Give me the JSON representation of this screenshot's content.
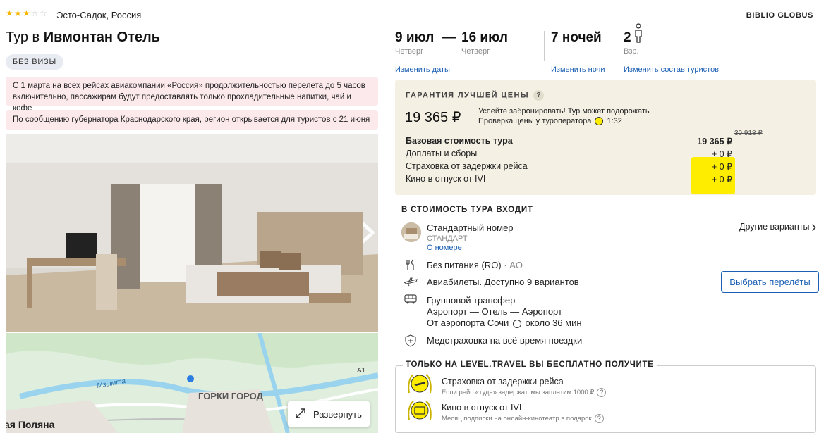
{
  "hotel": {
    "stars": 3,
    "max_stars": 5,
    "location": "Эсто-Садок, Россия",
    "title_prefix": "Тур в",
    "name": "Ивмонтан Отель",
    "visa_badge": "БЕЗ ВИЗЫ"
  },
  "operator": "BIBLIO GLOBUS",
  "notices": [
    "С 1 марта на всех рейсах авиакомпании «Россия» продолжительностью перелета до 5 часов включительно, пассажирам будут предоставлять только прохладительные напитки, чай и кофе",
    "По сообщению губернатора Краснодарского края, регион открывается для туристов с 21 июня"
  ],
  "map": {
    "labels": [
      "ГОРКИ ГОРОД",
      "ая Поляна",
      "Мзымта",
      "A1"
    ],
    "expand_label": "Развернуть"
  },
  "trip": {
    "date_from": "9 июл",
    "dash": "—",
    "date_to": "16 июл",
    "day_from": "Четверг",
    "day_to": "Четверг",
    "nights": "7 ночей",
    "travellers": "2",
    "travellers_label": "Взр.",
    "change_dates": "Изменить даты",
    "change_nights": "Изменить ночи",
    "change_travellers": "Изменить состав туристов"
  },
  "price": {
    "guarantee": "ГАРАНТИЯ ЛУЧШЕЙ ЦЕНЫ",
    "q": "?",
    "total": "19 365 ₽",
    "hurry": "Успейте забронировать! Тур может подорожать",
    "check": "Проверка цены у туроператора",
    "timer": "1:32",
    "old_price": "30 918 ₽",
    "rows": [
      {
        "label": "Базовая стоимость тура",
        "value": "19 365 ₽"
      },
      {
        "label": "Доплаты и сборы",
        "value": "+ 0 ₽"
      },
      {
        "label": "Страховка от задержки рейса",
        "value": "+ 0 ₽"
      },
      {
        "label": "Кино в отпуск от IVI",
        "value": "+ 0 ₽"
      }
    ]
  },
  "includes": {
    "heading": "В СТОИМОСТЬ ТУРА ВХОДИТ",
    "room_name": "Стандартный номер",
    "room_type": "СТАНДАРТ",
    "room_link": "О номере",
    "other_variants": "Другие варианты",
    "meal": "Без питания (RO)",
    "meal_code": "· AO",
    "flights": "Авиабилеты. Доступно 9 вариантов",
    "flights_button": "Выбрать перелёты",
    "transfer_title": "Групповой трансфер",
    "transfer_route": "Аэропорт — Отель — Аэропорт",
    "transfer_from": "От аэропорта Сочи",
    "transfer_time": "около 36 мин",
    "insurance": "Медстраховка на всё время поездки"
  },
  "bonus": {
    "heading": "ТОЛЬКО НА LEVEL.TRAVEL ВЫ БЕСПЛАТНО ПОЛУЧИТЕ",
    "items": [
      {
        "title": "Страховка от задержки рейса",
        "sub": "Если рейс «туда» задержат, мы заплатим 1000 ₽"
      },
      {
        "title": "Кино в отпуск от IVI",
        "sub": "Месяц подписки на онлайн-кинотеатр в подарок"
      }
    ]
  },
  "colors": {
    "accent": "#1a5fb4",
    "highlight": "#ffed00",
    "notice_bg": "#fbe9ec",
    "price_bg": "#f4f1e4"
  }
}
